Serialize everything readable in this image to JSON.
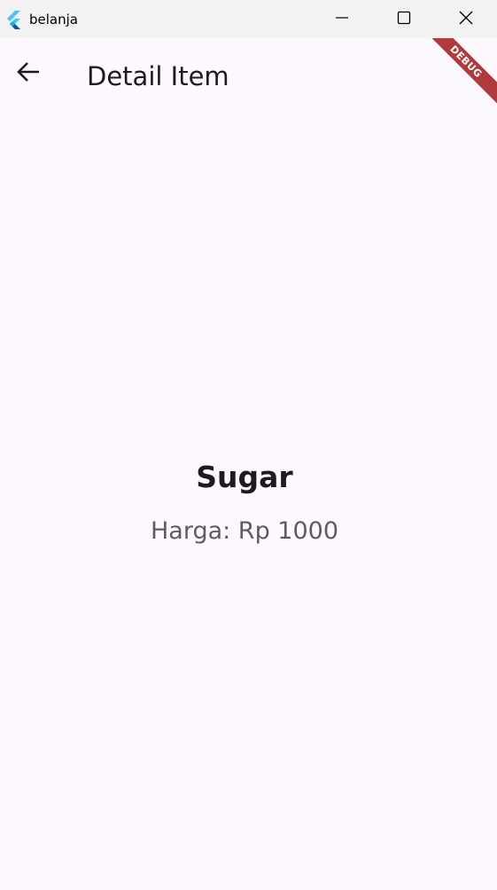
{
  "window": {
    "title": "belanja",
    "icon": "flutter-logo-icon",
    "controls": [
      "minimize-icon",
      "maximize-icon",
      "close-icon"
    ]
  },
  "appbar": {
    "back_icon": "arrow-back-icon",
    "title": "Detail Item"
  },
  "debug_banner": {
    "label": "DEBUG",
    "color": "#b33a3a"
  },
  "item": {
    "name": "Sugar",
    "price_text": "Harga: Rp 1000"
  },
  "colors": {
    "background": "#fdf7fe",
    "titlebar": "#f2f2f2",
    "text_primary": "#1d1b20",
    "text_secondary": "#5f5b64"
  }
}
